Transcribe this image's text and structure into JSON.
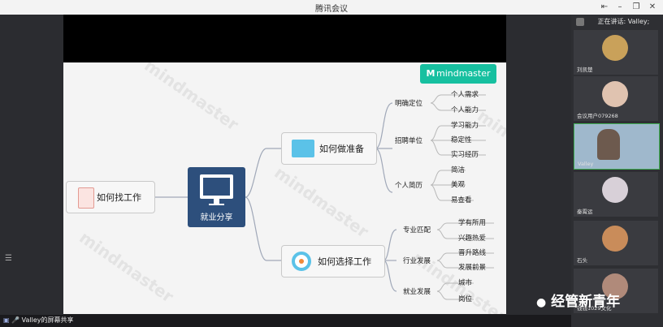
{
  "window": {
    "title": "腾讯会议"
  },
  "speaking": {
    "label": "正在讲话: Valley;"
  },
  "share_bar": {
    "label": "Valley的屏幕共享"
  },
  "mindmap": {
    "logo": "mindmaster",
    "watermark": "mindmaster",
    "center": "就业分享",
    "left_node": "如何找工作",
    "branch1": {
      "title": "如何做准备",
      "groups": [
        {
          "label": "明确定位",
          "items": [
            "个人需求",
            "个人能力"
          ]
        },
        {
          "label": "招聘单位",
          "items": [
            "学习能力",
            "稳定性",
            "实习经历"
          ]
        },
        {
          "label": "个人简历",
          "items": [
            "简洁",
            "美观",
            "易查看"
          ]
        }
      ]
    },
    "branch2": {
      "title": "如何选择工作",
      "groups": [
        {
          "label": "专业匹配",
          "items": [
            "学有所用",
            "兴趣热爱"
          ]
        },
        {
          "label": "行业发展",
          "items": [
            "晋升路线",
            "发展前景"
          ]
        },
        {
          "label": "就业发展",
          "items": [
            "城市",
            "岗位"
          ]
        }
      ]
    }
  },
  "participants": [
    {
      "name": "刘凯楚",
      "avatar_color": "#c9a15a"
    },
    {
      "name": "会议用户079268",
      "avatar_color": "#e0c3b0"
    },
    {
      "name": "Valley",
      "avatar_color": "#8fb4d8"
    },
    {
      "name": "秦霄运",
      "avatar_color": "#d8d0d8"
    },
    {
      "name": "石头",
      "avatar_color": "#c98c5a"
    },
    {
      "name": "钱钱1029文化",
      "avatar_color": "#b08a7a"
    }
  ],
  "watermark_brand": "经管新青年"
}
